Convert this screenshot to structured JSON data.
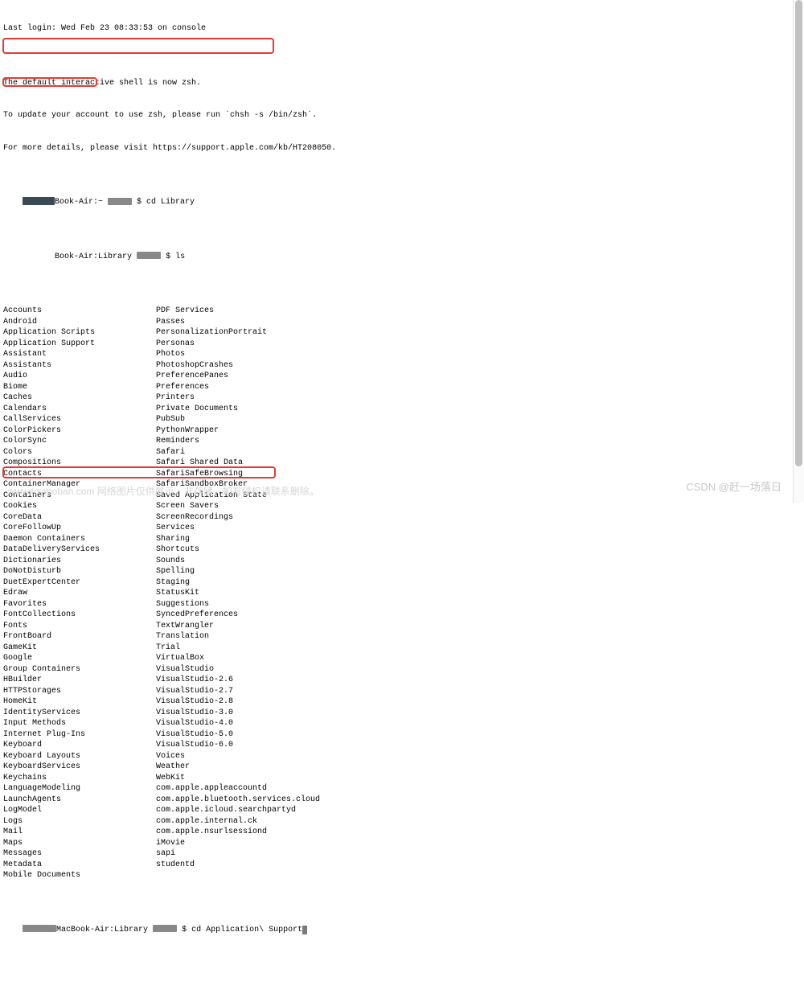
{
  "header": {
    "last_login": "Last login: Wed Feb 23 08:33:53 on console",
    "blank": "",
    "zsh1": "The default interactive shell is now zsh.",
    "zsh2": "To update your account to use zsh, please run `chsh -s /bin/zsh`.",
    "zsh3": "For more details, please visit https://support.apple.com/kb/HT208050."
  },
  "prompt1": {
    "host_left": "Book-Air:~ ",
    "cmd": "$ cd Library"
  },
  "prompt2": {
    "host_left": "Book-Air:Library ",
    "cmd": "$ ls"
  },
  "listing": [
    {
      "a": "Accounts",
      "b": "PDF Services"
    },
    {
      "a": "Android",
      "b": "Passes"
    },
    {
      "a": "Application Scripts",
      "b": "PersonalizationPortrait"
    },
    {
      "a": "Application Support",
      "b": "Personas"
    },
    {
      "a": "Assistant",
      "b": "Photos"
    },
    {
      "a": "Assistants",
      "b": "PhotoshopCrashes"
    },
    {
      "a": "Audio",
      "b": "PreferencePanes"
    },
    {
      "a": "Biome",
      "b": "Preferences"
    },
    {
      "a": "Caches",
      "b": "Printers"
    },
    {
      "a": "Calendars",
      "b": "Private Documents"
    },
    {
      "a": "CallServices",
      "b": "PubSub"
    },
    {
      "a": "ColorPickers",
      "b": "PythonWrapper"
    },
    {
      "a": "ColorSync",
      "b": "Reminders"
    },
    {
      "a": "Colors",
      "b": "Safari"
    },
    {
      "a": "Compositions",
      "b": "Safari Shared Data"
    },
    {
      "a": "Contacts",
      "b": "SafariSafeBrowsing"
    },
    {
      "a": "ContainerManager",
      "b": "SafariSandboxBroker"
    },
    {
      "a": "Containers",
      "b": "Saved Application State"
    },
    {
      "a": "Cookies",
      "b": "Screen Savers"
    },
    {
      "a": "CoreData",
      "b": "ScreenRecordings"
    },
    {
      "a": "CoreFollowUp",
      "b": "Services"
    },
    {
      "a": "Daemon Containers",
      "b": "Sharing"
    },
    {
      "a": "DataDeliveryServices",
      "b": "Shortcuts"
    },
    {
      "a": "Dictionaries",
      "b": "Sounds"
    },
    {
      "a": "DoNotDisturb",
      "b": "Spelling"
    },
    {
      "a": "DuetExpertCenter",
      "b": "Staging"
    },
    {
      "a": "Edraw",
      "b": "StatusKit"
    },
    {
      "a": "Favorites",
      "b": "Suggestions"
    },
    {
      "a": "FontCollections",
      "b": "SyncedPreferences"
    },
    {
      "a": "Fonts",
      "b": "TextWrangler"
    },
    {
      "a": "FrontBoard",
      "b": "Translation"
    },
    {
      "a": "GameKit",
      "b": "Trial"
    },
    {
      "a": "Google",
      "b": "VirtualBox"
    },
    {
      "a": "Group Containers",
      "b": "VisualStudio"
    },
    {
      "a": "HBuilder",
      "b": "VisualStudio-2.6"
    },
    {
      "a": "HTTPStorages",
      "b": "VisualStudio-2.7"
    },
    {
      "a": "HomeKit",
      "b": "VisualStudio-2.8"
    },
    {
      "a": "IdentityServices",
      "b": "VisualStudio-3.0"
    },
    {
      "a": "Input Methods",
      "b": "VisualStudio-4.0"
    },
    {
      "a": "Internet Plug-Ins",
      "b": "VisualStudio-5.0"
    },
    {
      "a": "Keyboard",
      "b": "VisualStudio-6.0"
    },
    {
      "a": "Keyboard Layouts",
      "b": "Voices"
    },
    {
      "a": "KeyboardServices",
      "b": "Weather"
    },
    {
      "a": "Keychains",
      "b": "WebKit"
    },
    {
      "a": "LanguageModeling",
      "b": "com.apple.appleaccountd"
    },
    {
      "a": "LaunchAgents",
      "b": "com.apple.bluetooth.services.cloud"
    },
    {
      "a": "LogModel",
      "b": "com.apple.icloud.searchpartyd"
    },
    {
      "a": "Logs",
      "b": "com.apple.internal.ck"
    },
    {
      "a": "Mail",
      "b": "com.apple.nsurlsessiond"
    },
    {
      "a": "Maps",
      "b": "iMovie"
    },
    {
      "a": "Messages",
      "b": "sapi"
    },
    {
      "a": "Metadata",
      "b": "studentd"
    },
    {
      "a": "Mobile Documents",
      "b": ""
    }
  ],
  "prompt3": {
    "host_left": "MacBook-Air:Library ",
    "cmd": "$ cd Application\\ Support"
  },
  "watermark": {
    "left": "www.toymoban.com  网络图片仅供展示，非存储，如有侵权请联系删除。",
    "right": "CSDN @赶一场落日"
  }
}
